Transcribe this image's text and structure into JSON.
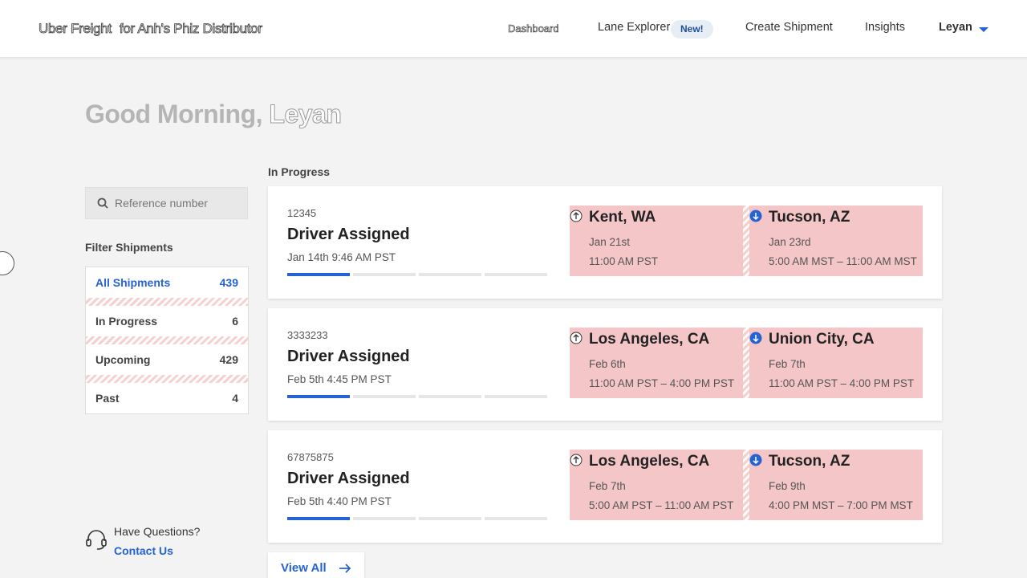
{
  "header": {
    "brand": "Uber Freight",
    "brand_sub": "for Anh's Phiz Distributor",
    "nav": {
      "dashboard": "Dashboard",
      "lane_explorer": "Lane Explorer",
      "lane_badge": "New!",
      "create_shipment": "Create Shipment",
      "insights": "Insights",
      "user": "Leyan"
    }
  },
  "greeting": {
    "prefix": "Good Morning,",
    "name": "Leyan"
  },
  "search": {
    "placeholder": "Reference number",
    "value": ""
  },
  "filters": {
    "title": "Filter Shipments",
    "items": [
      {
        "label": "All Shipments",
        "count": "439"
      },
      {
        "label": "In Progress",
        "count": "6"
      },
      {
        "label": "Upcoming",
        "count": "429"
      },
      {
        "label": "Past",
        "count": "4"
      }
    ]
  },
  "section_title": "In Progress",
  "shipments": [
    {
      "ref": "12345",
      "status": "Driver Assigned",
      "time": "Jan 14th 9:46 AM PST",
      "progress_steps_done": 1,
      "progress_steps_total": 4,
      "pickup": {
        "city": "Kent, WA",
        "date": "Jan 21st",
        "window": "11:00 AM PST"
      },
      "dropoff": {
        "city": "Tucson, AZ",
        "date": "Jan 23rd",
        "window": "5:00 AM MST – 11:00 AM MST"
      }
    },
    {
      "ref": "3333233",
      "status": "Driver Assigned",
      "time": "Feb 5th 4:45 PM PST",
      "progress_steps_done": 1,
      "progress_steps_total": 4,
      "pickup": {
        "city": "Los Angeles, CA",
        "date": "Feb 6th",
        "window": "11:00 AM PST – 4:00 PM PST"
      },
      "dropoff": {
        "city": "Union City, CA",
        "date": "Feb 7th",
        "window": "11:00 AM PST – 4:00 PM PST"
      }
    },
    {
      "ref": "67875875",
      "status": "Driver Assigned",
      "time": "Feb 5th 4:40 PM PST",
      "progress_steps_done": 1,
      "progress_steps_total": 4,
      "pickup": {
        "city": "Los Angeles, CA",
        "date": "Feb 7th",
        "window": "5:00 AM PST – 11:00 AM PST"
      },
      "dropoff": {
        "city": "Tucson, AZ",
        "date": "Feb 9th",
        "window": "4:00 PM MST – 7:00 PM MST"
      }
    }
  ],
  "view_all": "View All",
  "help": {
    "question": "Have Questions?",
    "link": "Contact Us"
  },
  "colors": {
    "accent": "#2563d4",
    "stop_bg": "#f5c6c8"
  }
}
